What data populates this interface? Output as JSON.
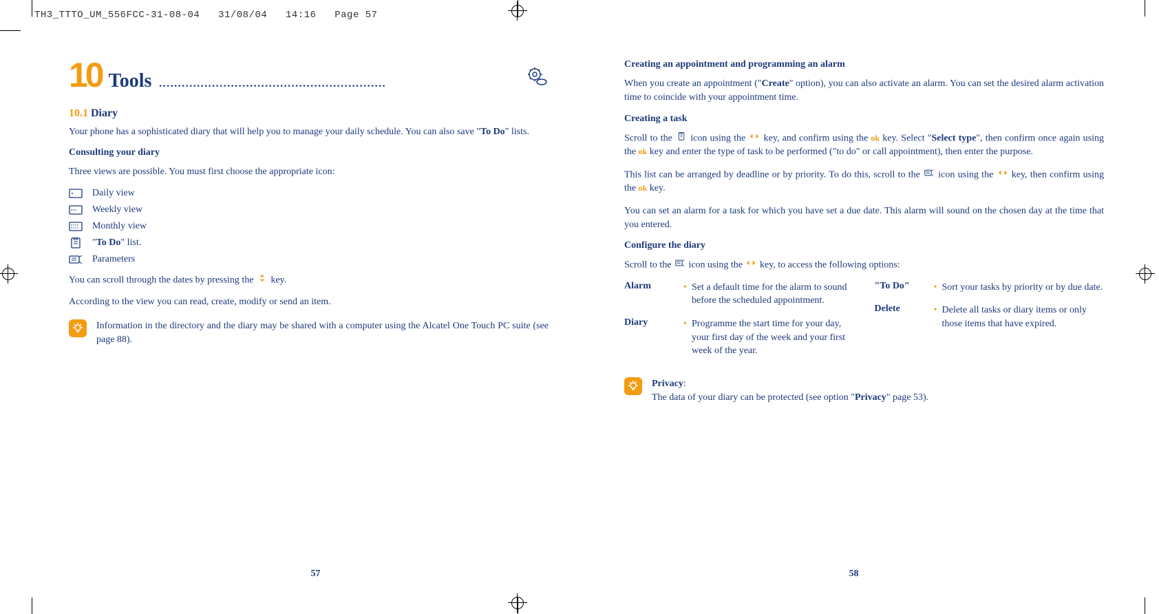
{
  "header": {
    "filename": "TH3_TTTO_UM_556FCC-31-08-04",
    "date": "31/08/04",
    "time": "14:16",
    "pageref": "Page 57"
  },
  "left": {
    "chapter_num": "10",
    "chapter_title": "Tools",
    "section_num": "10.1",
    "section_title": "Diary",
    "intro": "Your phone has a sophisticated diary that will help you to manage your daily schedule. You can also save \"",
    "intro_bold": "To Do",
    "intro_after": "\" lists.",
    "consulting_head": "Consulting your diary",
    "consulting_text": "Three views are possible. You must first choose the appropriate icon:",
    "views": [
      {
        "label": "Daily view"
      },
      {
        "label": "Weekly view"
      },
      {
        "label": "Monthly view"
      },
      {
        "label_pre": "\"",
        "label_bold": "To Do",
        "label_post": "\" list."
      },
      {
        "label": "Parameters"
      }
    ],
    "scroll_text_before": "You can scroll through the dates by pressing the ",
    "scroll_text_after": " key.",
    "according_text": "According to the view you can read, create, modify or send an item.",
    "tip": "Information in the directory and the diary may be shared with a computer using the Alcatel One Touch PC suite (see page 88).",
    "pagenum": "57"
  },
  "right": {
    "h1": "Creating an appointment and programming an alarm",
    "p1_before": "When you create an appointment (\"",
    "p1_bold": "Create",
    "p1_after": "\" option), you can also activate an alarm. You can set the desired alarm activation time to coincide with your appointment time.",
    "h2": "Creating a task",
    "p2_a": "Scroll to the ",
    "p2_b": " icon using the ",
    "p2_c": " key, and confirm using the ",
    "p2_d": " key. Select \"",
    "p2_bold": "Select type",
    "p2_e": "\", then confirm once again using the ",
    "p2_f": " key and enter the type of task to be performed (\"to do\" or call appointment), then enter the purpose.",
    "p3_a": "This list can be arranged by deadline or by priority. To do this, scroll to the ",
    "p3_b": " icon using the ",
    "p3_c": " key, then confirm using the ",
    "p3_d": " key.",
    "p4": "You can set an alarm for a task for which you have set a due date. This alarm will sound on the chosen day at the time that you entered.",
    "h3": "Configure the diary",
    "p5_a": "Scroll to the ",
    "p5_b": " icon using the ",
    "p5_c": " key, to access the following options:",
    "options_left": [
      {
        "label": "Alarm",
        "desc": "Set a default time for the alarm to sound before the scheduled appointment."
      },
      {
        "label": "Diary",
        "desc": "Programme the start time for your day, your first day of the week and your first week of the year."
      }
    ],
    "options_right": [
      {
        "label": "\"To Do\"",
        "desc": "Sort your tasks by priority or by due date."
      },
      {
        "label": "Delete",
        "desc": "Delete all tasks or diary items or only those items that have expired."
      }
    ],
    "tip_label": "Privacy",
    "tip_text_a": "The data of your diary can be protected (see option \"",
    "tip_text_bold": "Privacy",
    "tip_text_b": "\" page 53).",
    "ok_label": "ok",
    "pagenum": "58"
  }
}
